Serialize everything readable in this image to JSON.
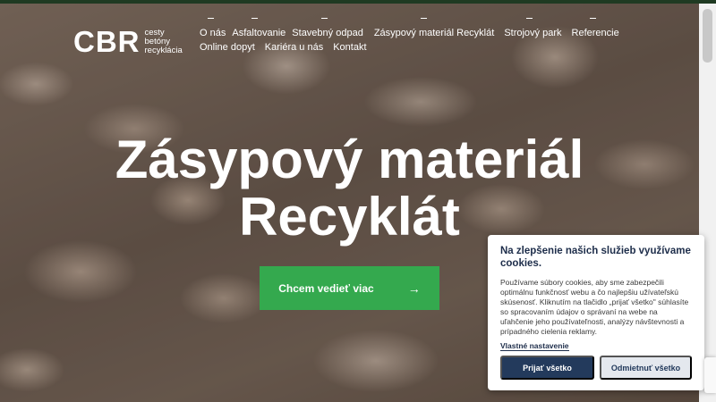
{
  "logo": {
    "mark": "CBR",
    "sub_lines": [
      "cesty",
      "betóny",
      "recyklácia"
    ]
  },
  "nav": {
    "row1": [
      {
        "label": "O nás",
        "dash": true
      },
      {
        "label": "Asfaltovanie",
        "dash": true
      },
      {
        "label": "Stavebný odpad",
        "dash": true
      },
      {
        "label": "Zásypový materiál Recyklát",
        "dash": false
      },
      {
        "label": "Strojový park",
        "dash": true
      },
      {
        "label": "Referencie",
        "dash": true
      }
    ],
    "row2": [
      {
        "label": "Online dopyt"
      },
      {
        "label": "Kariéra u nás"
      },
      {
        "label": "Kontakt"
      }
    ]
  },
  "hero": {
    "line1": "Zásypový materiál",
    "line2": "Recyklát",
    "cta_label": "Chcem vedieť viac",
    "cta_arrow": "→"
  },
  "cookie": {
    "title": "Na zlepšenie našich služieb využívame cookies.",
    "text": "Používame súbory cookies, aby sme zabezpečili optimálnu funkčnosť webu a čo najlepšiu užívateľskú skúsenosť. Kliknutím na tlačidlo „prijať všetko\" súhlasíte so spracovaním údajov o správaní na webe na uľahčenie jeho používateľnosti, analýzy návštevnosti a prípadného cielenia reklamy.",
    "settings_link": "Vlastné nastavenie",
    "accept_label": "Prijať všetko",
    "reject_label": "Odmietnuť všetko"
  },
  "colors": {
    "accent_green": "#34a94e",
    "dark_navy": "#233a5c",
    "topbar": "#1f3a22"
  }
}
